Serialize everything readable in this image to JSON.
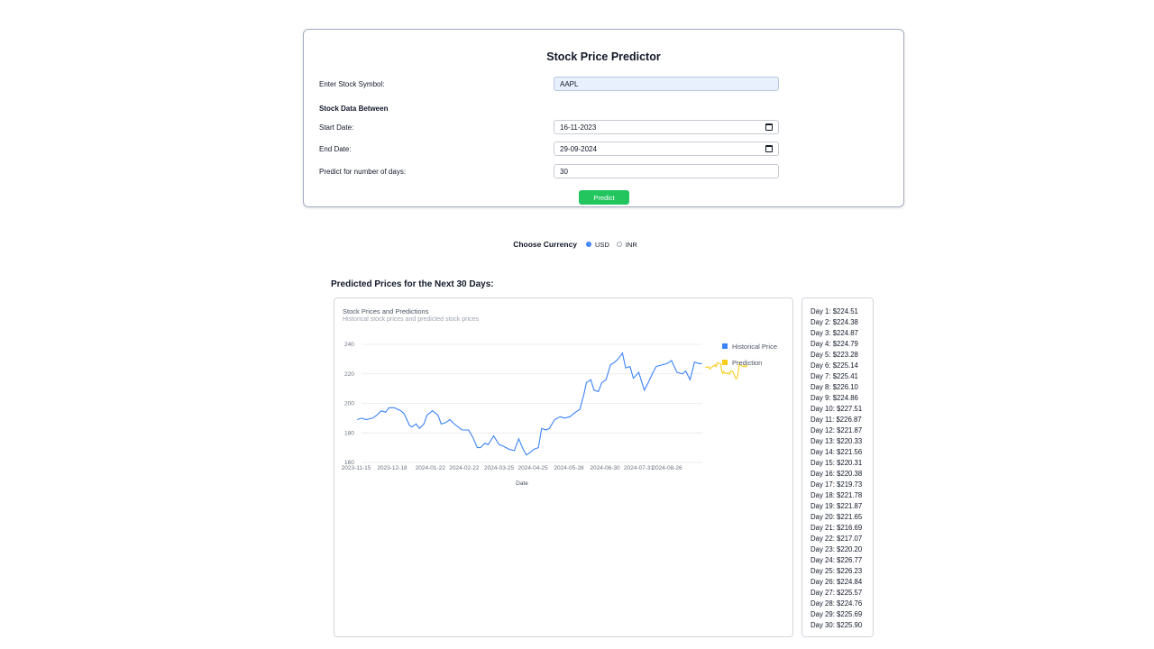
{
  "form": {
    "title": "Stock Price Predictor",
    "symbol_label": "Enter Stock Symbol:",
    "symbol_value": "AAPL",
    "section_label": "Stock Data Between",
    "start_label": "Start Date:",
    "start_value": "16-11-2023",
    "end_label": "End Date:",
    "end_value": "29-09-2024",
    "days_label": "Predict for number of days:",
    "days_value": "30",
    "predict_button": "Predict"
  },
  "currency": {
    "label": "Choose Currency",
    "options": [
      "USD",
      "INR"
    ],
    "selected": "USD"
  },
  "results": {
    "title": "Predicted Prices for the Next 30 Days:",
    "predictions": [
      "Day 1: $224.51",
      "Day 2: $224.38",
      "Day 3: $224.87",
      "Day 4: $224.79",
      "Day 5: $223.28",
      "Day 6: $225.14",
      "Day 7: $225.41",
      "Day 8: $226.10",
      "Day 9: $224.86",
      "Day 10: $227.51",
      "Day 11: $226.87",
      "Day 12: $221.87",
      "Day 13: $220.33",
      "Day 14: $221.56",
      "Day 15: $220.31",
      "Day 16: $220.38",
      "Day 17: $219.73",
      "Day 18: $221.78",
      "Day 19: $221.87",
      "Day 20: $221.65",
      "Day 21: $216.69",
      "Day 22: $217.07",
      "Day 23: $220.20",
      "Day 24: $226.77",
      "Day 25: $226.23",
      "Day 26: $224.84",
      "Day 27: $225.57",
      "Day 28: $224.76",
      "Day 29: $225.69",
      "Day 30: $225.90"
    ]
  },
  "colors": {
    "historical": "#3b82f6",
    "prediction": "#facc15",
    "predict_button": "#22c55e"
  },
  "chart_data": {
    "type": "line",
    "title": "Stock Prices and Predictions",
    "subtitle": "Historical stock prices and predicted stock prices",
    "xlabel": "Date",
    "ylabel": "",
    "ylim": [
      160,
      240
    ],
    "yticks": [
      160,
      180,
      200,
      220,
      240
    ],
    "grid": true,
    "legend_position": "right",
    "x_tick_labels": [
      "2023-11-15",
      "2023-12-18",
      "2024-01-22",
      "2024-02-22",
      "2024-03-25",
      "2024-04-25",
      "2024-05-28",
      "2024-06-30",
      "2024-07-31",
      "2024-08-26"
    ],
    "series": [
      {
        "name": "Historical Price",
        "points": [
          [
            "2023-11-16",
            189
          ],
          [
            "2023-11-20",
            190
          ],
          [
            "2023-11-24",
            189
          ],
          [
            "2023-11-30",
            190
          ],
          [
            "2023-12-04",
            192
          ],
          [
            "2023-12-08",
            195
          ],
          [
            "2023-12-12",
            194
          ],
          [
            "2023-12-15",
            197
          ],
          [
            "2023-12-20",
            197
          ],
          [
            "2023-12-26",
            195
          ],
          [
            "2023-12-29",
            193
          ],
          [
            "2024-01-03",
            185
          ],
          [
            "2024-01-05",
            184
          ],
          [
            "2024-01-09",
            186
          ],
          [
            "2024-01-12",
            183
          ],
          [
            "2024-01-16",
            186
          ],
          [
            "2024-01-19",
            192
          ],
          [
            "2024-01-24",
            195
          ],
          [
            "2024-01-29",
            192
          ],
          [
            "2024-02-01",
            186
          ],
          [
            "2024-02-05",
            187
          ],
          [
            "2024-02-09",
            189
          ],
          [
            "2024-02-13",
            186
          ],
          [
            "2024-02-20",
            182
          ],
          [
            "2024-02-26",
            182
          ],
          [
            "2024-03-01",
            177
          ],
          [
            "2024-03-05",
            170
          ],
          [
            "2024-03-08",
            170
          ],
          [
            "2024-03-12",
            173
          ],
          [
            "2024-03-15",
            172
          ],
          [
            "2024-03-20",
            178
          ],
          [
            "2024-03-25",
            172
          ],
          [
            "2024-03-29",
            171
          ],
          [
            "2024-04-03",
            169
          ],
          [
            "2024-04-08",
            168
          ],
          [
            "2024-04-12",
            176
          ],
          [
            "2024-04-16",
            169
          ],
          [
            "2024-04-19",
            165
          ],
          [
            "2024-04-23",
            167
          ],
          [
            "2024-04-26",
            169
          ],
          [
            "2024-04-30",
            170
          ],
          [
            "2024-05-03",
            183
          ],
          [
            "2024-05-07",
            182
          ],
          [
            "2024-05-10",
            183
          ],
          [
            "2024-05-15",
            189
          ],
          [
            "2024-05-20",
            191
          ],
          [
            "2024-05-24",
            190
          ],
          [
            "2024-05-29",
            191
          ],
          [
            "2024-06-03",
            194
          ],
          [
            "2024-06-07",
            196
          ],
          [
            "2024-06-11",
            207
          ],
          [
            "2024-06-13",
            214
          ],
          [
            "2024-06-17",
            216
          ],
          [
            "2024-06-20",
            209
          ],
          [
            "2024-06-24",
            208
          ],
          [
            "2024-06-27",
            214
          ],
          [
            "2024-07-01",
            216
          ],
          [
            "2024-07-05",
            226
          ],
          [
            "2024-07-09",
            228
          ],
          [
            "2024-07-12",
            230
          ],
          [
            "2024-07-16",
            234
          ],
          [
            "2024-07-19",
            224
          ],
          [
            "2024-07-23",
            225
          ],
          [
            "2024-07-26",
            217
          ],
          [
            "2024-07-31",
            221
          ],
          [
            "2024-08-05",
            209
          ],
          [
            "2024-08-08",
            213
          ],
          [
            "2024-08-13",
            221
          ],
          [
            "2024-08-16",
            225
          ],
          [
            "2024-08-21",
            226
          ],
          [
            "2024-08-26",
            227
          ],
          [
            "2024-08-30",
            229
          ],
          [
            "2024-09-04",
            221
          ],
          [
            "2024-09-09",
            220
          ],
          [
            "2024-09-12",
            222
          ],
          [
            "2024-09-16",
            216
          ],
          [
            "2024-09-20",
            228
          ],
          [
            "2024-09-24",
            227
          ],
          [
            "2024-09-27",
            227
          ]
        ]
      },
      {
        "name": "Prediction",
        "values": [
          224.51,
          224.38,
          224.87,
          224.79,
          223.28,
          225.14,
          225.41,
          226.1,
          224.86,
          227.51,
          226.87,
          221.87,
          220.33,
          221.56,
          220.31,
          220.38,
          219.73,
          221.78,
          221.87,
          221.65,
          216.69,
          217.07,
          220.2,
          226.77,
          226.23,
          224.84,
          225.57,
          224.76,
          225.69,
          225.9
        ]
      }
    ]
  }
}
